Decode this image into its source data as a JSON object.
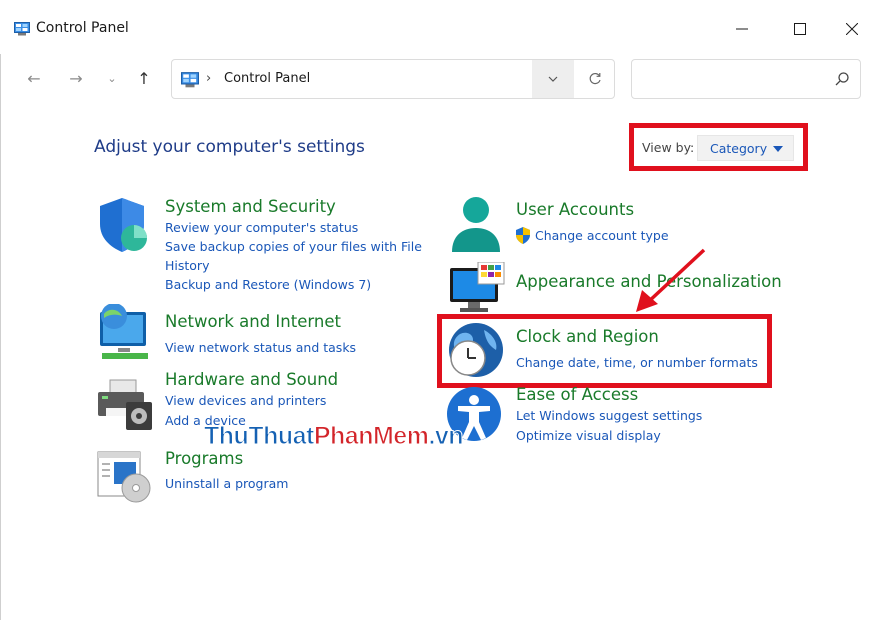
{
  "window": {
    "title": "Control Panel",
    "controls": {
      "minimize": "minimize-icon",
      "maximize": "maximize-icon",
      "close": "close-icon"
    }
  },
  "nav": {
    "back_icon": "←",
    "forward_icon": "→",
    "recent_icon": "⌄",
    "up_icon": "↑"
  },
  "address": {
    "separator": "›",
    "location": "Control Panel"
  },
  "search": {
    "placeholder": ""
  },
  "main": {
    "heading": "Adjust your computer's settings",
    "view_by": {
      "label": "View by:",
      "value": "Category"
    }
  },
  "categories": [
    {
      "title": "System and Security",
      "icon": "shield-icon",
      "links": [
        "Review your computer's status",
        "Save backup copies of your files with File",
        "History",
        "Backup and Restore (Windows 7)"
      ]
    },
    {
      "title": "Network and Internet",
      "icon": "network-icon",
      "links": [
        "View network status and tasks"
      ]
    },
    {
      "title": "Hardware and Sound",
      "icon": "printer-icon",
      "links": [
        "View devices and printers",
        "Add a device"
      ]
    },
    {
      "title": "Programs",
      "icon": "programs-icon",
      "links": [
        "Uninstall a program"
      ]
    },
    {
      "title": "User Accounts",
      "icon": "user-icon",
      "links": [
        "Change account type"
      ]
    },
    {
      "title": "Appearance and Personalization",
      "icon": "monitor-icon",
      "links": []
    },
    {
      "title": "Clock and Region",
      "icon": "clock-globe-icon",
      "links": [
        "Change date, time, or number formats"
      ]
    },
    {
      "title": "Ease of Access",
      "icon": "accessibility-icon",
      "links": [
        "Let Windows suggest settings",
        "Optimize visual display"
      ]
    }
  ],
  "watermark": {
    "part1": "ThuThuat",
    "part2": "PhanMem",
    "part3": ".vn"
  },
  "colors": {
    "link": "#1a57b8",
    "category": "#197a2a",
    "highlight": "#e0101d",
    "heading": "#1f3c88"
  }
}
